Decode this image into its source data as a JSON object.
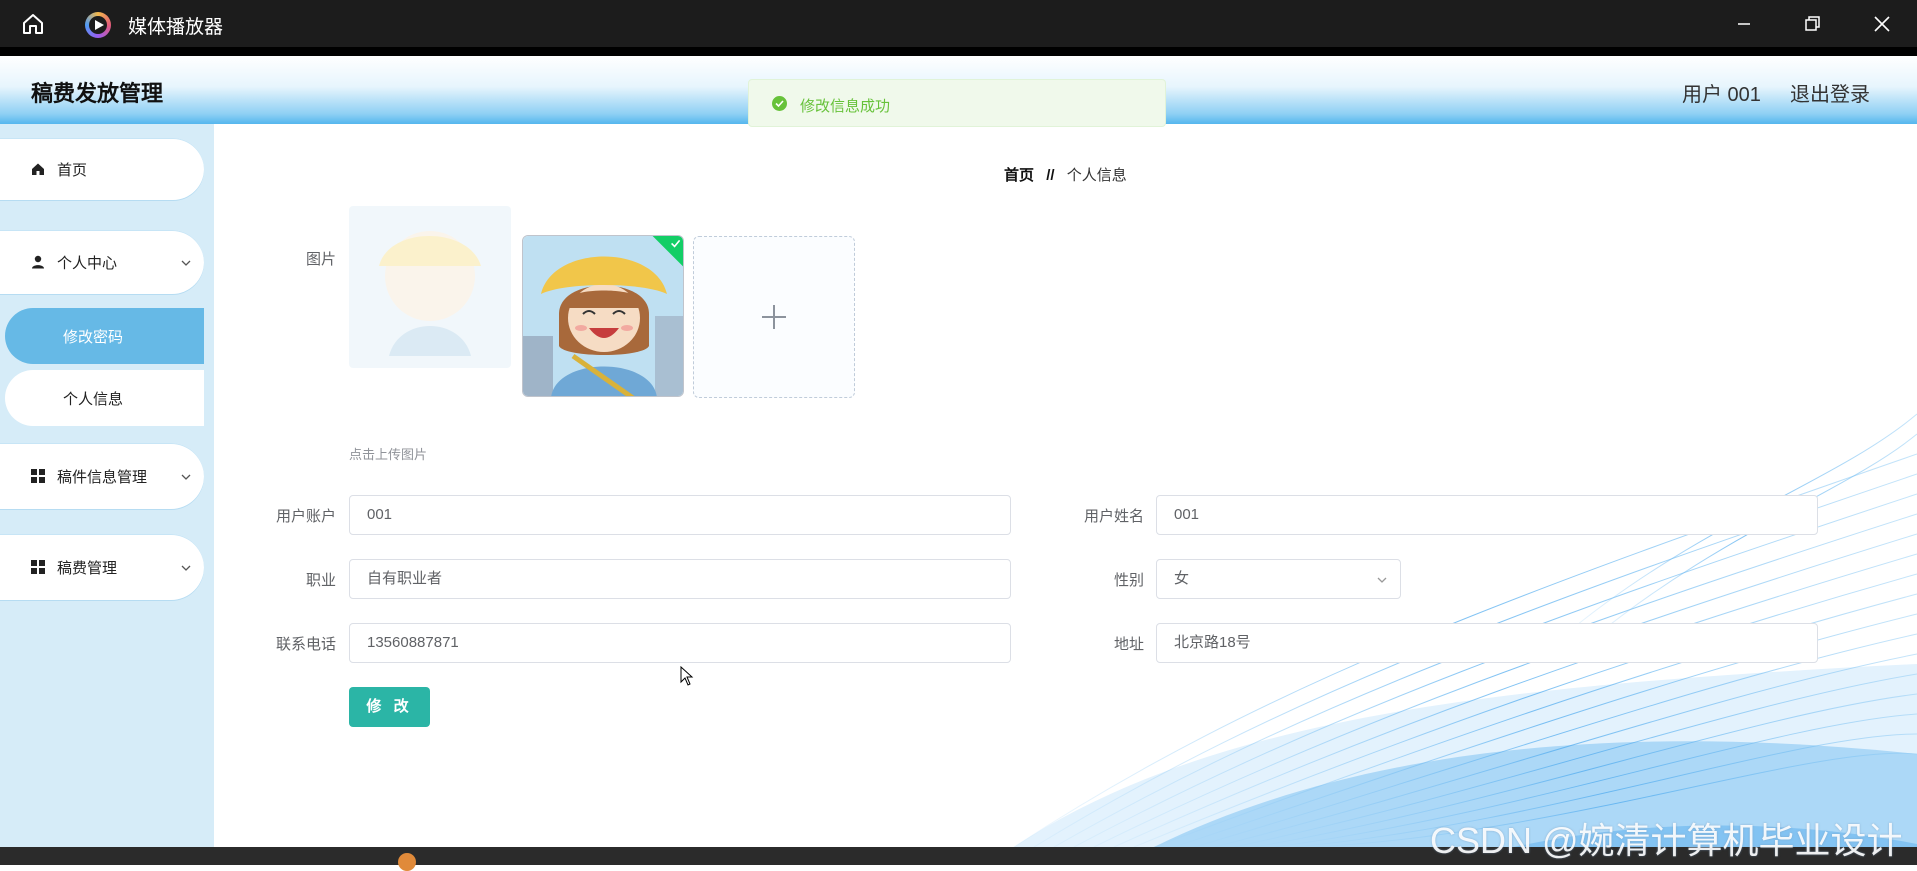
{
  "window": {
    "title": "媒体播放器"
  },
  "header": {
    "brand": "稿费发放管理",
    "user": "用户 001",
    "logout": "退出登录"
  },
  "toast": {
    "message": "修改信息成功"
  },
  "sidebar": {
    "items": [
      {
        "label": "首页",
        "icon": "home-icon"
      },
      {
        "label": "个人中心",
        "icon": "user-icon",
        "expanded": true,
        "children": [
          {
            "label": "修改密码",
            "active": true
          },
          {
            "label": "个人信息",
            "active": false
          }
        ]
      },
      {
        "label": "稿件信息管理",
        "icon": "grid-icon"
      },
      {
        "label": "稿费管理",
        "icon": "grid-icon"
      }
    ]
  },
  "breadcrumb": {
    "home": "首页",
    "separator": "//",
    "current": "个人信息"
  },
  "form": {
    "image_label": "图片",
    "upload_hint": "点击上传图片",
    "account": {
      "label": "用户账户",
      "value": "001"
    },
    "name": {
      "label": "用户姓名",
      "value": "001"
    },
    "job": {
      "label": "职业",
      "value": "自有职业者"
    },
    "gender": {
      "label": "性别",
      "value": "女"
    },
    "phone": {
      "label": "联系电话",
      "value": "13560887871"
    },
    "address": {
      "label": "地址",
      "value": "北京路18号"
    },
    "submit": "修 改"
  },
  "watermark": "CSDN @婉清计算机毕业设计",
  "colors": {
    "accent": "#2bb5a6",
    "sidebar_active": "#66b9e6",
    "sidebar_bg": "#d6ecf8",
    "success": "#67c23a"
  }
}
